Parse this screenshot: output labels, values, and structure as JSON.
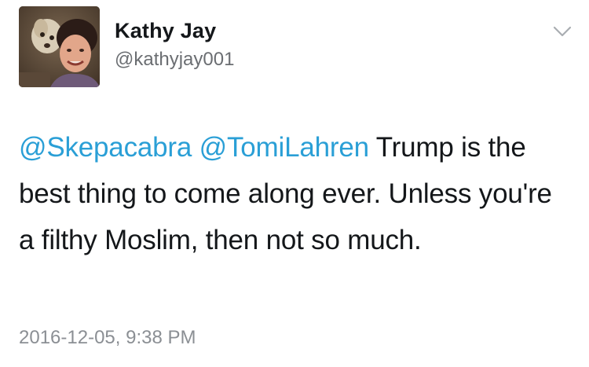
{
  "tweet": {
    "author": {
      "display_name": "Kathy Jay",
      "handle": "@kathyjay001",
      "avatar_icon": "profile-photo"
    },
    "menu_icon": "chevron-down-icon",
    "text": {
      "mention_1": "@Skepacabra",
      "mention_2": "@TomiLahren",
      "body": "Trump is the best thing to come along ever. Unless you're a filthy Moslim, then not so much."
    },
    "timestamp": "2016-12-05, 9:38 PM"
  },
  "colors": {
    "mention": "#2a9fd6",
    "text": "#14171a",
    "secondary": "#8b8f94"
  }
}
